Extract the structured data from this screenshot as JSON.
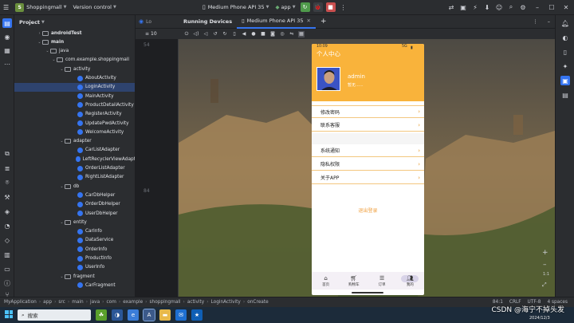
{
  "titlebar": {
    "project_badge": "S",
    "project_name": "Shoppingmall",
    "vcs": "Version control",
    "device": "Medium Phone API 35",
    "run_config": "app"
  },
  "project_panel": {
    "title": "Project",
    "tree": [
      {
        "label": "androidTest",
        "type": "folder",
        "bold": true
      },
      {
        "label": "main",
        "type": "folder",
        "bold": true
      },
      {
        "label": "java",
        "type": "folder"
      },
      {
        "label": "com.example.shoppingmall",
        "type": "folder"
      },
      {
        "label": "activity",
        "type": "folder"
      },
      {
        "label": "AboutActivity",
        "type": "class"
      },
      {
        "label": "LoginActivity",
        "type": "class",
        "selected": true
      },
      {
        "label": "MainActivity",
        "type": "class"
      },
      {
        "label": "ProductDetailActivity",
        "type": "class"
      },
      {
        "label": "RegisterActivity",
        "type": "class"
      },
      {
        "label": "UpdatePwdActivity",
        "type": "class"
      },
      {
        "label": "WelcomeActivity",
        "type": "class"
      },
      {
        "label": "adapter",
        "type": "folder"
      },
      {
        "label": "CarListAdapter",
        "type": "class"
      },
      {
        "label": "LeftRecyclerViewAdapt",
        "type": "class"
      },
      {
        "label": "OrderListAdapter",
        "type": "class"
      },
      {
        "label": "RightListAdapter",
        "type": "class"
      },
      {
        "label": "db",
        "type": "folder"
      },
      {
        "label": "CarDbHelper",
        "type": "class"
      },
      {
        "label": "OrderDbHelper",
        "type": "class"
      },
      {
        "label": "UserDbHelper",
        "type": "class"
      },
      {
        "label": "entity",
        "type": "folder"
      },
      {
        "label": "CarInfo",
        "type": "class"
      },
      {
        "label": "DataService",
        "type": "class"
      },
      {
        "label": "OrderInfo",
        "type": "class"
      },
      {
        "label": "ProductInfo",
        "type": "class"
      },
      {
        "label": "UserInfo",
        "type": "class"
      },
      {
        "label": "fragment",
        "type": "folder"
      },
      {
        "label": "CarFragment",
        "type": "class"
      }
    ]
  },
  "editor": {
    "tab": "10",
    "line_numbers": [
      "54",
      "84"
    ]
  },
  "running_devices": {
    "panel_title": "Running Devices",
    "device_tab": "Medium Phone API 35"
  },
  "phone": {
    "time": "10:09",
    "signal": "5G",
    "page_title": "个人中心",
    "username": "admin",
    "user_sub": "暂无......",
    "menu_group1": [
      "修改密码",
      "联系客服"
    ],
    "menu_group2": [
      "系统通知",
      "隐私权限",
      "关于APP"
    ],
    "logout": "退出登录",
    "nav": [
      "首页",
      "购物车",
      "订单",
      "我的"
    ],
    "nav_active_index": 3
  },
  "ide_status": {
    "breadcrumbs": [
      "MyApplication",
      "app",
      "src",
      "main",
      "java",
      "com",
      "example",
      "shoppingmall",
      "activity",
      "LoginActivity",
      "onCreate"
    ],
    "position": "84:1",
    "line_sep": "CRLF",
    "encoding": "UTF-8",
    "indent": "4 spaces"
  },
  "taskbar": {
    "search_placeholder": "搜索",
    "date": "2024/12/3"
  },
  "watermark": "CSDN @海宁不掉头发"
}
